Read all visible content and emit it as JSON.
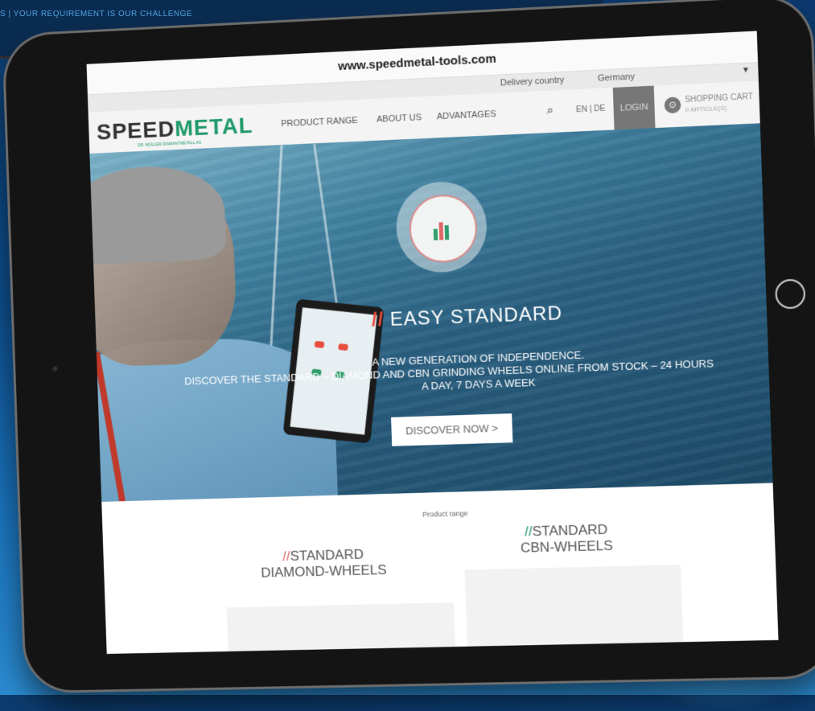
{
  "background": {
    "tagline": "S | YOUR REQUIREMENT IS OUR CHALLENGE"
  },
  "browser": {
    "url": "www.speedmetal-tools.com"
  },
  "delivery": {
    "label": "Delivery country",
    "value": "Germany"
  },
  "nav": {
    "logo_speed": "SPEED",
    "logo_metal": "METAL",
    "logo_sub": "DR. MÜLLER DIAMANTMETALL AG",
    "items": [
      {
        "label": "PRODUCT RANGE"
      },
      {
        "label": "ABOUT US"
      },
      {
        "label": "ADVANTAGES"
      }
    ],
    "lang": "EN | DE",
    "login": "LOGIN",
    "cart_label": "SHOPPING CART",
    "cart_sub": "0 ARTICLE(S)"
  },
  "hero": {
    "title": "EASY STANDARD",
    "line1": "A NEW GENERATION OF INDEPENDENCE.",
    "line2": "DISCOVER THE STANDARD – DIAMOND AND CBN GRINDING WHEELS ONLINE FROM STOCK – 24 HOURS",
    "line3": "A DAY, 7 DAYS A WEEK",
    "button": "DISCOVER NOW >"
  },
  "products": {
    "label": "Product range",
    "items": [
      {
        "line1": "STANDARD",
        "line2": "DIAMOND-WHEELS"
      },
      {
        "line1": "STANDARD",
        "line2": "CBN-WHEELS"
      }
    ]
  },
  "colors": {
    "brand_green": "#1f9a6b",
    "accent_red": "#e74c3c"
  }
}
